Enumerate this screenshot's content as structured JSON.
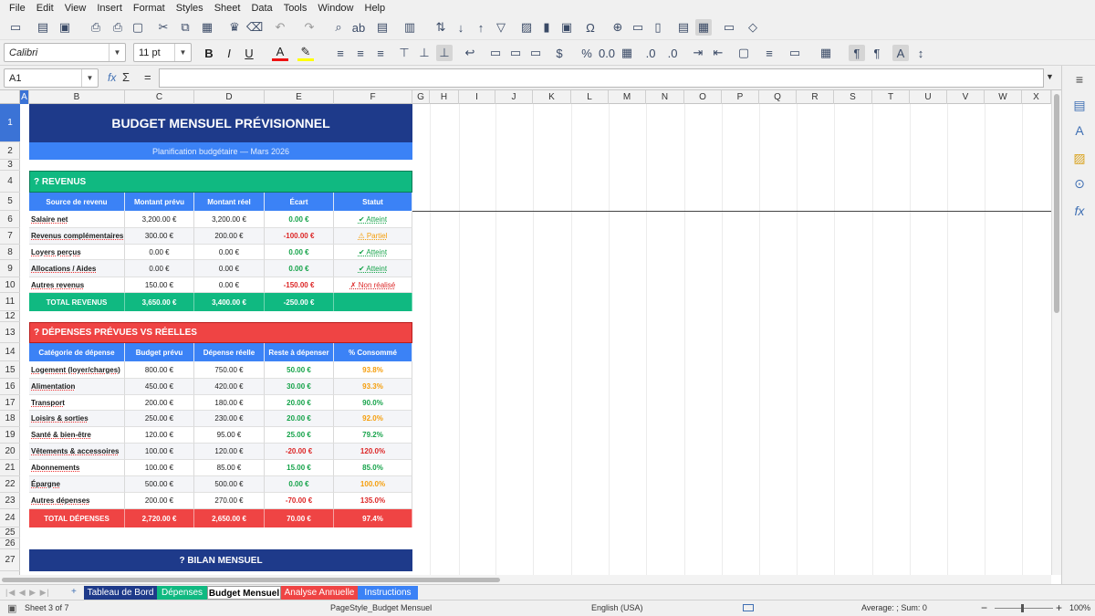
{
  "menu": [
    "File",
    "Edit",
    "View",
    "Insert",
    "Format",
    "Styles",
    "Sheet",
    "Data",
    "Tools",
    "Window",
    "Help"
  ],
  "toolbar": {
    "font_name": "Calibri",
    "font_size": "11 pt"
  },
  "formula_bar": {
    "cell_ref": "A1",
    "fx": "fx",
    "sum": "Σ",
    "eq": "=",
    "content": ""
  },
  "columns": [
    "A",
    "B",
    "C",
    "D",
    "E",
    "F",
    "G",
    "H",
    "I",
    "J",
    "K",
    "L",
    "M",
    "N",
    "O",
    "P",
    "Q",
    "R",
    "S",
    "T",
    "U",
    "V",
    "W",
    "X"
  ],
  "rows": [
    "1",
    "2",
    "3",
    "4",
    "5",
    "6",
    "7",
    "8",
    "9",
    "10",
    "11",
    "12",
    "13",
    "14",
    "15",
    "16",
    "17",
    "18",
    "19",
    "20",
    "21",
    "22",
    "23",
    "24",
    "25",
    "26",
    "27"
  ],
  "sheet": {
    "title": "BUDGET MENSUEL PRÉVISIONNEL",
    "subtitle": "Planification budgétaire — Mars 2026",
    "revenus": {
      "header": "? REVENUS",
      "columns": [
        "Source de revenu",
        "Montant prévu",
        "Montant réel",
        "Écart",
        "Statut"
      ],
      "rows": [
        {
          "label": "Salaire net",
          "prevu": "3,200.00 €",
          "reel": "3,200.00 €",
          "ecart": "0.00 €",
          "statut": "✔ Atteint",
          "cls": "g"
        },
        {
          "label": "Revenus complémentaires",
          "prevu": "300.00 €",
          "reel": "200.00 €",
          "ecart": "-100.00 €",
          "statut": "⚠ Partiel",
          "cls": "o"
        },
        {
          "label": "Loyers perçus",
          "prevu": "0.00 €",
          "reel": "0.00 €",
          "ecart": "0.00 €",
          "statut": "✔ Atteint",
          "cls": "g"
        },
        {
          "label": "Allocations / Aides",
          "prevu": "0.00 €",
          "reel": "0.00 €",
          "ecart": "0.00 €",
          "statut": "✔ Atteint",
          "cls": "g"
        },
        {
          "label": "Autres revenus",
          "prevu": "150.00 €",
          "reel": "0.00 €",
          "ecart": "-150.00 €",
          "statut": "✗ Non réalisé",
          "cls": "r"
        }
      ],
      "total": {
        "label": "TOTAL REVENUS",
        "prevu": "3,650.00 €",
        "reel": "3,400.00 €",
        "ecart": "-250.00 €",
        "statut": ""
      }
    },
    "depenses": {
      "header": "? DÉPENSES PRÉVUES VS RÉELLES",
      "columns": [
        "Catégorie de dépense",
        "Budget prévu",
        "Dépense réelle",
        "Reste à dépenser",
        "% Consommé"
      ],
      "rows": [
        {
          "label": "Logement (loyer/charges)",
          "prevu": "800.00 €",
          "reel": "750.00 €",
          "reste": "50.00 €",
          "pct": "93.8%",
          "rc": "g",
          "pc": "o"
        },
        {
          "label": "Alimentation",
          "prevu": "450.00 €",
          "reel": "420.00 €",
          "reste": "30.00 €",
          "pct": "93.3%",
          "rc": "g",
          "pc": "o"
        },
        {
          "label": "Transport",
          "prevu": "200.00 €",
          "reel": "180.00 €",
          "reste": "20.00 €",
          "pct": "90.0%",
          "rc": "g",
          "pc": "g"
        },
        {
          "label": "Loisirs & sorties",
          "prevu": "250.00 €",
          "reel": "230.00 €",
          "reste": "20.00 €",
          "pct": "92.0%",
          "rc": "g",
          "pc": "o"
        },
        {
          "label": "Santé & bien-être",
          "prevu": "120.00 €",
          "reel": "95.00 €",
          "reste": "25.00 €",
          "pct": "79.2%",
          "rc": "g",
          "pc": "g"
        },
        {
          "label": "Vêtements & accessoires",
          "prevu": "100.00 €",
          "reel": "120.00 €",
          "reste": "-20.00 €",
          "pct": "120.0%",
          "rc": "r",
          "pc": "r"
        },
        {
          "label": "Abonnements",
          "prevu": "100.00 €",
          "reel": "85.00 €",
          "reste": "15.00 €",
          "pct": "85.0%",
          "rc": "g",
          "pc": "g"
        },
        {
          "label": "Épargne",
          "prevu": "500.00 €",
          "reel": "500.00 €",
          "reste": "0.00 €",
          "pct": "100.0%",
          "rc": "g",
          "pc": "o"
        },
        {
          "label": "Autres dépenses",
          "prevu": "200.00 €",
          "reel": "270.00 €",
          "reste": "-70.00 €",
          "pct": "135.0%",
          "rc": "r",
          "pc": "r"
        }
      ],
      "total": {
        "label": "TOTAL DÉPENSES",
        "prevu": "2,720.00 €",
        "reel": "2,650.00 €",
        "reste": "70.00 €",
        "pct": "97.4%"
      }
    },
    "bilan": {
      "header": "? BILAN MENSUEL"
    }
  },
  "sheet_tabs": [
    {
      "label": "Tableau de Bord",
      "color": "#1e3a8a",
      "text": "#ffffff"
    },
    {
      "label": "Dépenses",
      "color": "#10b981",
      "text": "#ffffff"
    },
    {
      "label": "Budget Mensuel",
      "color": "#ffffff",
      "text": "#000000"
    },
    {
      "label": "Analyse Annuelle",
      "color": "#ef4444",
      "text": "#ffffff"
    },
    {
      "label": "Instructions",
      "color": "#3b82f6",
      "text": "#ffffff"
    }
  ],
  "status": {
    "sheet": "Sheet 3 of 7",
    "page_style": "PageStyle_Budget Mensuel",
    "language": "English (USA)",
    "summary": "Average: ; Sum: 0",
    "zoom": "100%"
  },
  "colors": {
    "navy": "#1e3a8a",
    "blue": "#3b82f6",
    "green": "#10b981",
    "red": "#ef4444"
  }
}
